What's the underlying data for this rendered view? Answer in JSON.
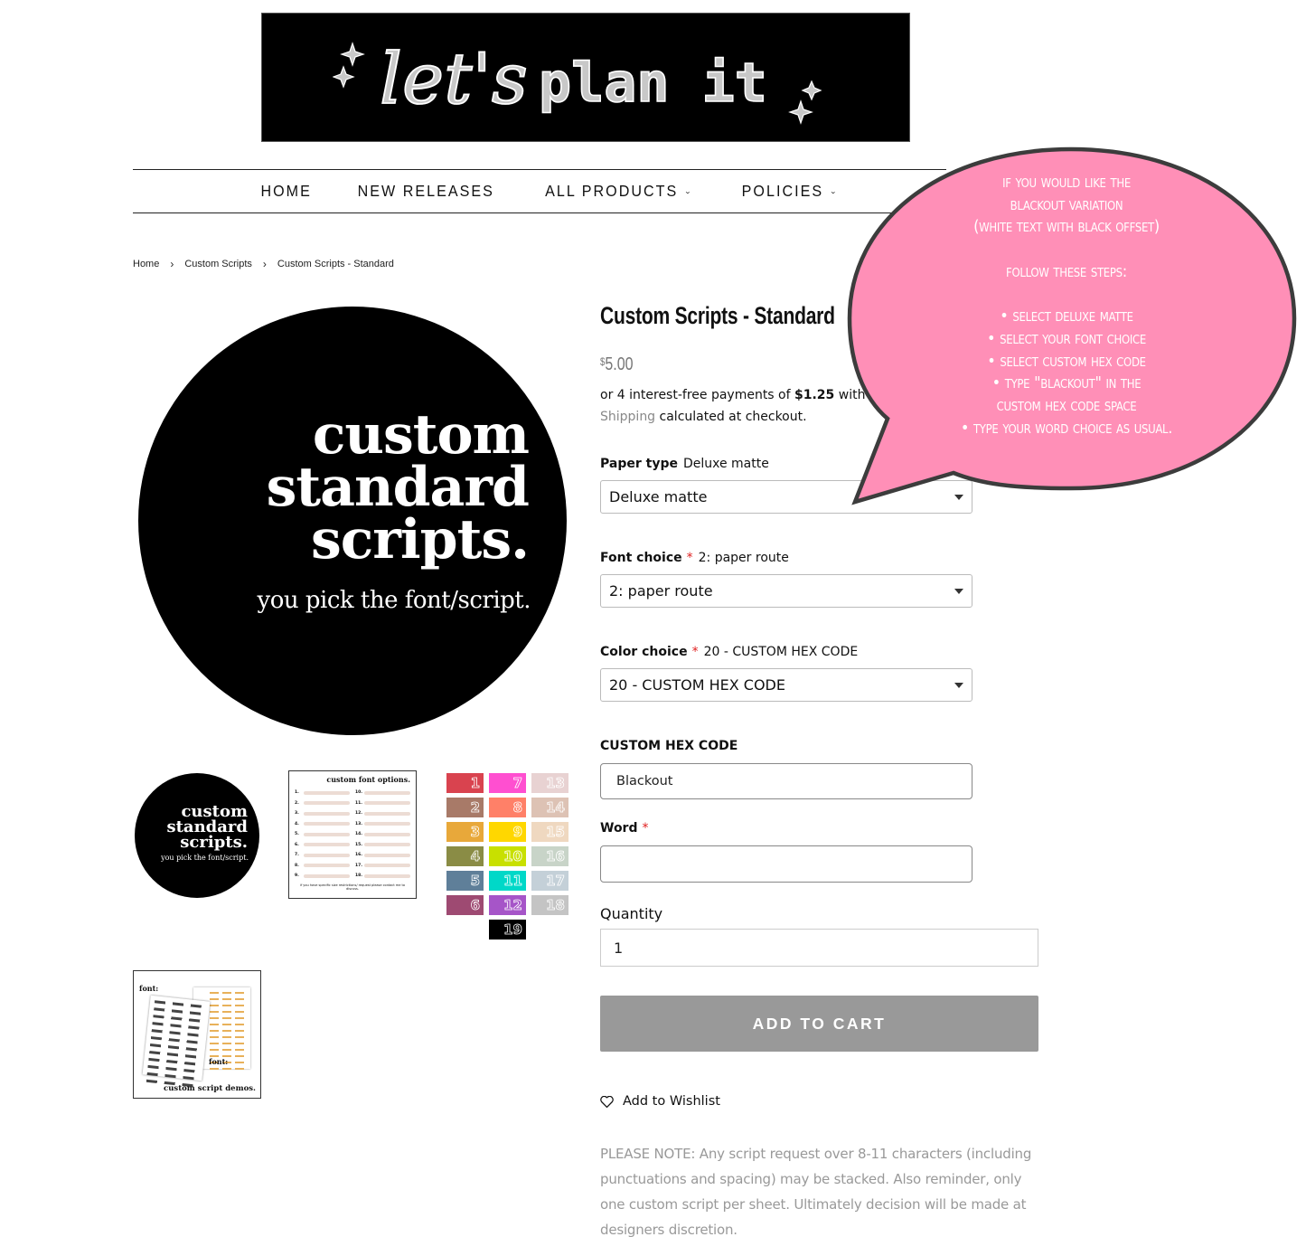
{
  "header": {
    "logo_text": "let's plan it"
  },
  "nav": {
    "items": [
      {
        "label": "HOME",
        "has_dropdown": false
      },
      {
        "label": "NEW RELEASES",
        "has_dropdown": false
      },
      {
        "label": "ALL PRODUCTS",
        "has_dropdown": true
      },
      {
        "label": "POLICIES",
        "has_dropdown": true
      }
    ]
  },
  "breadcrumb": {
    "items": [
      "Home",
      "Custom Scripts",
      "Custom Scripts - Standard"
    ],
    "separator": "›"
  },
  "gallery": {
    "main_image": {
      "headline_lines": [
        "custom",
        "standard",
        "scripts."
      ],
      "subline": "you pick the font/script."
    },
    "thumb_circle": {
      "headline_lines": [
        "custom",
        "standard",
        "scripts."
      ],
      "subline": "you pick the font/script."
    },
    "thumb_fonts": {
      "title": "custom font options.",
      "footer": "if you have specific size restrictions/ request please contact me to discuss.",
      "left_numbers": [
        "1.",
        "2.",
        "3.",
        "4.",
        "5.",
        "6.",
        "7.",
        "8.",
        "9."
      ],
      "right_numbers": [
        "10.",
        "11.",
        "12.",
        "13.",
        "14.",
        "15.",
        "16.",
        "17.",
        "18."
      ]
    },
    "swatches": [
      {
        "n": "1",
        "color": "#d9434f"
      },
      {
        "n": "2",
        "color": "#a87a68"
      },
      {
        "n": "3",
        "color": "#e8a83a"
      },
      {
        "n": "4",
        "color": "#8a8c45"
      },
      {
        "n": "5",
        "color": "#5f7f99"
      },
      {
        "n": "6",
        "color": "#9e4a72"
      },
      {
        "n": "7",
        "color": "#ff4fd0"
      },
      {
        "n": "8",
        "color": "#ff8068"
      },
      {
        "n": "9",
        "color": "#ffd700"
      },
      {
        "n": "10",
        "color": "#c8e000"
      },
      {
        "n": "11",
        "color": "#00d8c8"
      },
      {
        "n": "12",
        "color": "#a655c8"
      },
      {
        "n": "13",
        "color": "#e8d2d2"
      },
      {
        "n": "14",
        "color": "#ddc2b4"
      },
      {
        "n": "15",
        "color": "#efd8c0"
      },
      {
        "n": "16",
        "color": "#c8d4c8"
      },
      {
        "n": "17",
        "color": "#c4d0d8"
      },
      {
        "n": "18",
        "color": "#c4c4c4"
      },
      {
        "n": "19",
        "color": "#000000"
      }
    ],
    "thumb_demo": {
      "font_label_1": "font:",
      "font_label_2": "font:",
      "caption": "custom script demos."
    }
  },
  "product": {
    "title": "Custom Scripts - Standard",
    "price_symbol": "$",
    "price": "5.00",
    "installments_prefix": "or 4 interest-free payments of ",
    "installment_amount": "$1.25",
    "installments_suffix": " with",
    "shipping_link": "Shipping",
    "shipping_suffix": " calculated at checkout."
  },
  "options": {
    "paper_type": {
      "label": "Paper type",
      "selected": "Deluxe matte",
      "required": false
    },
    "font_choice": {
      "label": "Font choice",
      "selected": "2: paper route",
      "required": true
    },
    "color_choice": {
      "label": "Color choice",
      "selected": "20 - CUSTOM HEX CODE",
      "required": true
    },
    "custom_hex": {
      "label": "CUSTOM HEX CODE",
      "value": "Blackout"
    },
    "word": {
      "label": "Word",
      "value": "",
      "required": true
    },
    "quantity": {
      "label": "Quantity",
      "value": "1"
    },
    "required_marker": "*"
  },
  "actions": {
    "add_to_cart": "ADD TO CART",
    "wishlist": "Add to Wishlist"
  },
  "note": "PLEASE NOTE: Any script request over 8-11 characters (including punctuations and spacing) may be stacked. Also reminder, only one custom script per sheet. Ultimately decision will be made at designers discretion.",
  "callout": {
    "intro_lines": [
      "if you would like the",
      "blackout variation",
      "(white text with black offset)"
    ],
    "steps_heading": "follow these steps:",
    "steps": [
      "• select deluxe matte",
      "• select your font choice",
      "• select custom hex code",
      "• type \"blackout\" in the",
      "custom hex code space",
      "• type your word choice as usual."
    ],
    "color": "#ff8fb7"
  },
  "colors": {
    "add_to_cart_bg": "#999999",
    "required": "#e02020",
    "muted_text": "#999999"
  }
}
